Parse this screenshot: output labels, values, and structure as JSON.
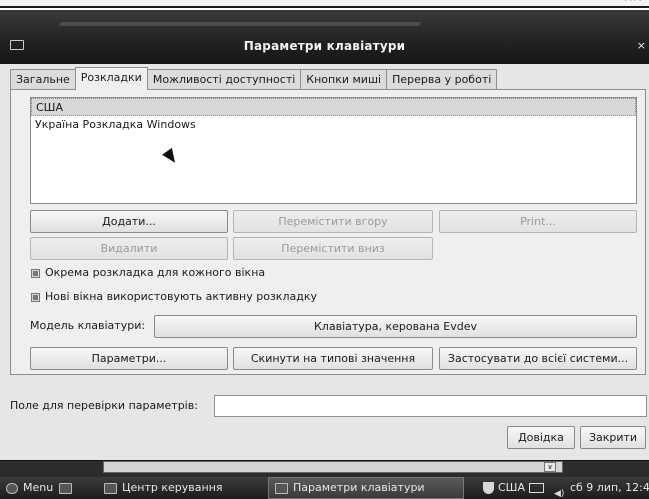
{
  "window": {
    "title": "Параметри клавіатури"
  },
  "tabs": [
    {
      "label": "Загальне"
    },
    {
      "label": "Розкладки"
    },
    {
      "label": "Можливості доступності"
    },
    {
      "label": "Кнопки миші"
    },
    {
      "label": "Перерва у роботі"
    }
  ],
  "layouts": {
    "items": [
      "США",
      "Україна Розкладка Windows"
    ]
  },
  "buttons": {
    "add": "Додати...",
    "move_up": "Перемістити вгору",
    "print": "Print...",
    "remove": "Видалити",
    "move_down": "Перемістити вниз",
    "options": "Параметри...",
    "reset": "Скинути на типові значення",
    "apply_system": "Застосувати до всієї системи...",
    "help": "Довідка",
    "close": "Закрити"
  },
  "checkboxes": {
    "separate": "Окрема розкладка для кожного вікна",
    "new_windows": "Нові вікна використовують активну розкладку"
  },
  "model": {
    "label": "Модель клавіатури:",
    "value": "Клавіатура, керована Evdev"
  },
  "test": {
    "label": "Поле для перевірки параметрів:",
    "value": ""
  },
  "taskbar": {
    "menu": "Menu",
    "control_center": "Центр керування",
    "active_window": "Параметри клавіатури",
    "layout_indicator": "США",
    "clock": "сб 9 лип, 12:4"
  }
}
